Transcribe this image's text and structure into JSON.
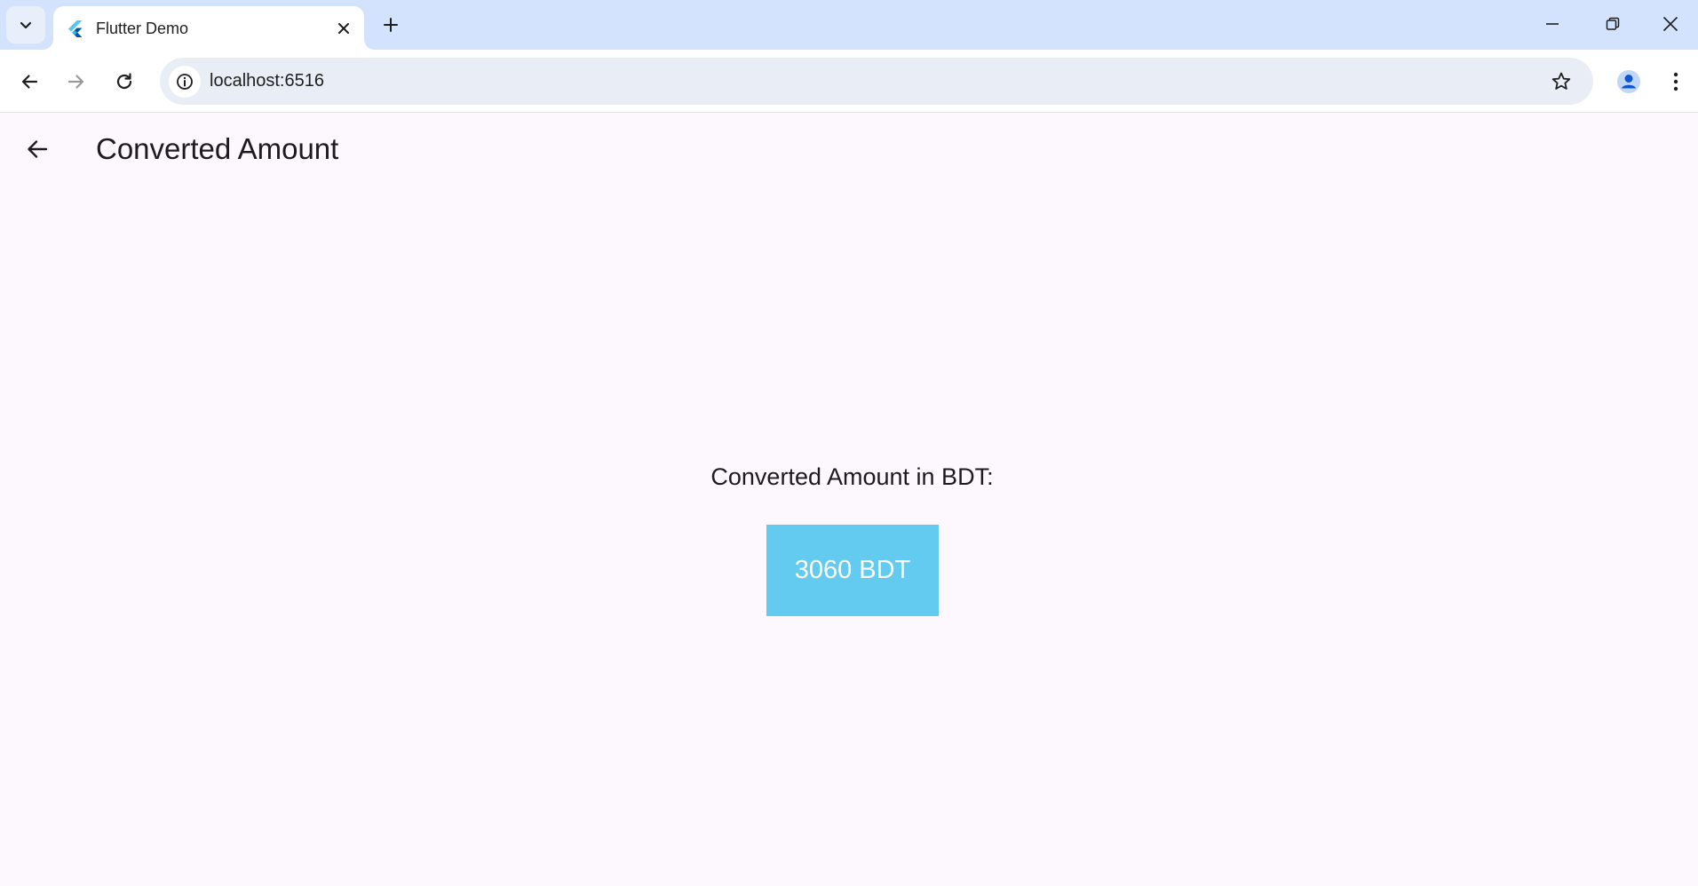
{
  "browser": {
    "tab": {
      "title": "Flutter Demo",
      "favicon": "flutter-logo-icon"
    },
    "address_bar": {
      "url": "localhost:6516"
    },
    "icons": {
      "tab_search": "chevron-down-icon",
      "tab_close": "close-icon",
      "new_tab": "plus-icon",
      "minimize": "minimize-icon",
      "restore": "restore-icon",
      "window_close": "close-icon",
      "back": "arrow-left-icon",
      "forward": "arrow-right-icon",
      "reload": "reload-icon",
      "site_info": "info-icon",
      "bookmark": "star-icon",
      "profile": "person-icon",
      "menu": "more-vert-icon"
    }
  },
  "app": {
    "appbar": {
      "title": "Converted Amount",
      "back_icon": "arrow-left-icon"
    },
    "result_label": "Converted Amount in BDT:",
    "amount": "3060 BDT",
    "colors": {
      "background": "#fdf7fe",
      "amount_box": "#63cbef",
      "amount_text": "#ffffff",
      "tabstrip": "#d3e3fd",
      "omnibox": "#e9eef6"
    }
  }
}
